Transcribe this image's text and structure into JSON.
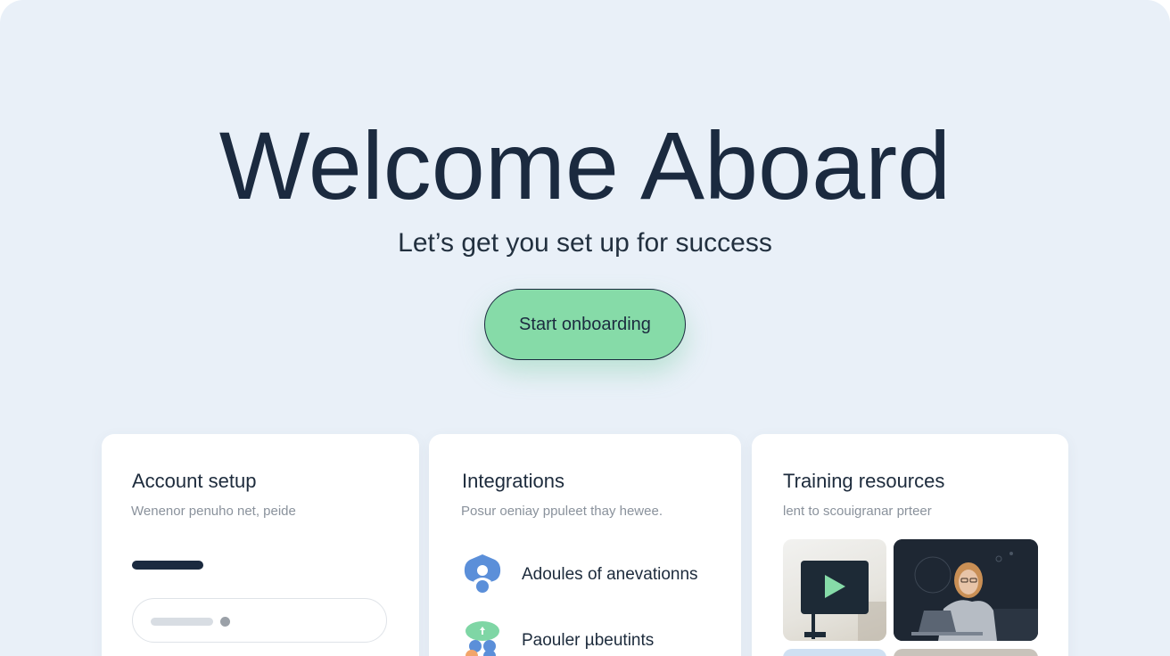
{
  "hero": {
    "title": "Welcome Aboard",
    "subtitle": "Let’s get you set up for success",
    "cta_label": "Start onboarding"
  },
  "cards": {
    "account": {
      "title": "Account setup",
      "description": "Wenenor penuho net, peide"
    },
    "integrations": {
      "title": "Integrations",
      "description": "Posur oeniay ppuleet thay hewee.",
      "items": [
        {
          "label": "Adoules of anevationns",
          "icon": "user-shield-icon"
        },
        {
          "label": "Paouler µbeutints",
          "icon": "cloud-upload-icon"
        }
      ]
    },
    "training": {
      "title": "Training resources",
      "description": "lent to scouigranar prteer",
      "thumbnails": [
        {
          "icon": "play-video-icon"
        },
        {
          "icon": "person-laptop-image"
        }
      ]
    }
  },
  "colors": {
    "background": "#e9f0f8",
    "accent_green": "#86dba8",
    "navy": "#1b2a3f"
  }
}
